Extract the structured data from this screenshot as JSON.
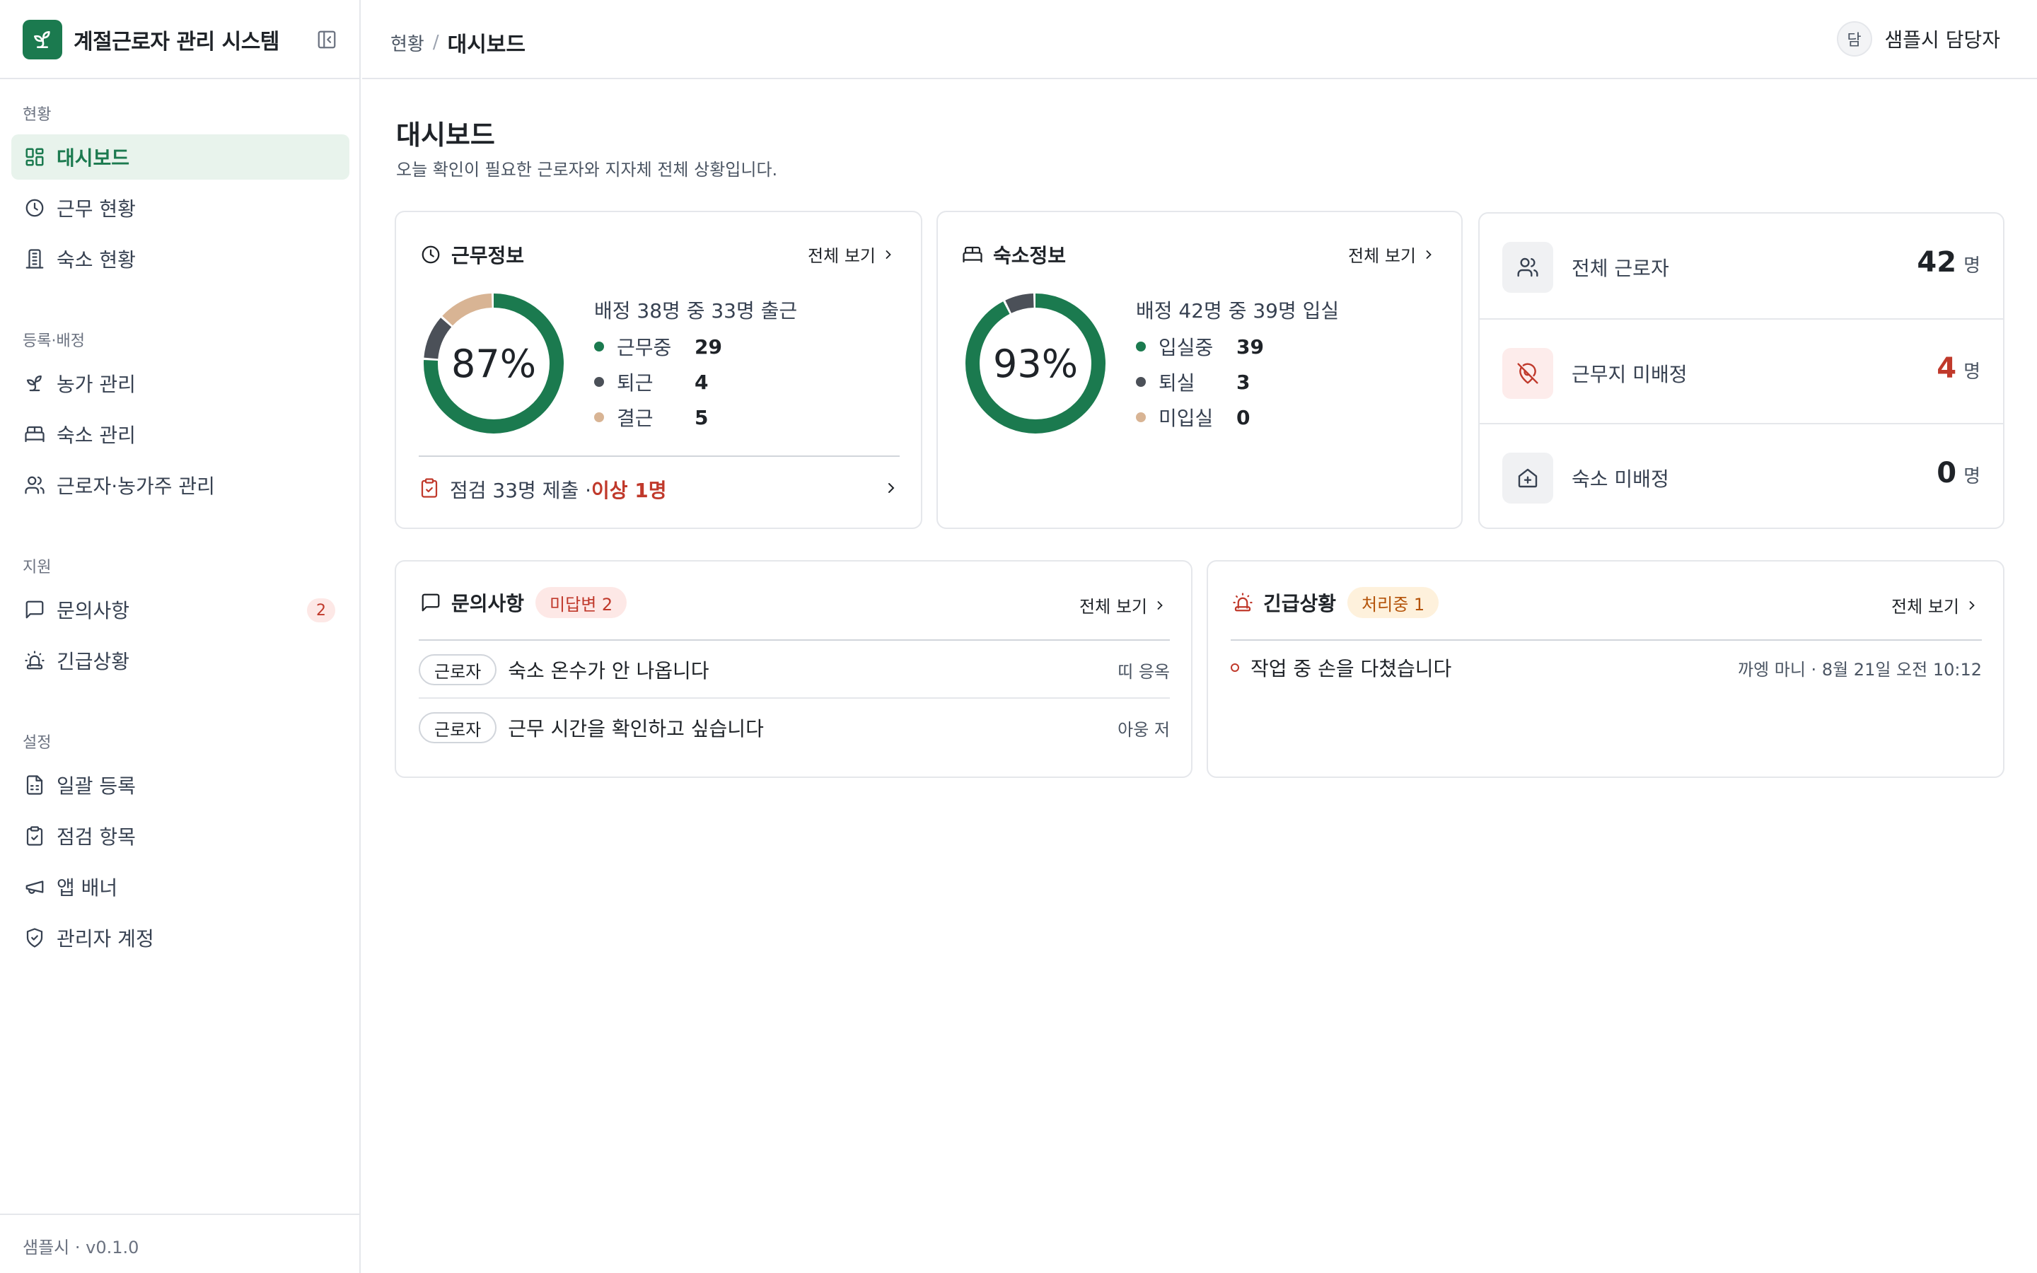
{
  "app": {
    "title": "계절근로자 관리 시스템",
    "version": "샘플시 · v0.1.0"
  },
  "sidebar": {
    "sections": [
      {
        "title": "현황",
        "items": [
          {
            "label": "대시보드",
            "icon": "dashboard-icon",
            "active": true
          },
          {
            "label": "근무 현황",
            "icon": "clock-icon"
          },
          {
            "label": "숙소 현황",
            "icon": "building-icon"
          }
        ]
      },
      {
        "title": "등록·배정",
        "items": [
          {
            "label": "농가 관리",
            "icon": "sprout-icon"
          },
          {
            "label": "숙소 관리",
            "icon": "bed-icon"
          },
          {
            "label": "근로자·농가주 관리",
            "icon": "users-icon"
          }
        ]
      },
      {
        "title": "지원",
        "items": [
          {
            "label": "문의사항",
            "icon": "message-icon",
            "badge": "2"
          },
          {
            "label": "긴급상황",
            "icon": "siren-icon"
          }
        ]
      },
      {
        "title": "설정",
        "items": [
          {
            "label": "일괄 등록",
            "icon": "file-spreadsheet-icon"
          },
          {
            "label": "점검 항목",
            "icon": "clipboard-check-icon"
          },
          {
            "label": "앱 배너",
            "icon": "megaphone-icon"
          },
          {
            "label": "관리자 계정",
            "icon": "shield-check-icon"
          }
        ]
      }
    ]
  },
  "topbar": {
    "breadcrumb_parent": "현황",
    "breadcrumb_sep": "/",
    "breadcrumb_current": "대시보드",
    "user_avatar": "담",
    "user_name": "샘플시 담당자"
  },
  "page": {
    "title": "대시보드",
    "subtitle": "오늘 확인이 필요한 근로자와 지자체 전체 상황입니다."
  },
  "work_card": {
    "title": "근무정보",
    "view_all": "전체 보기",
    "percent": "87%",
    "summary": "배정 38명 중 33명 출근",
    "legend": [
      {
        "label": "근무중",
        "value": "29",
        "color": "#1b7a4f"
      },
      {
        "label": "퇴근",
        "value": "4",
        "color": "#4b5058"
      },
      {
        "label": "결근",
        "value": "5",
        "color": "#d8b494"
      }
    ],
    "inspect_text": "점검 33명 제출 · ",
    "inspect_alert": "이상 1명"
  },
  "housing_card": {
    "title": "숙소정보",
    "view_all": "전체 보기",
    "percent": "93%",
    "summary": "배정 42명 중 39명 입실",
    "legend": [
      {
        "label": "입실중",
        "value": "39",
        "color": "#1b7a4f"
      },
      {
        "label": "퇴실",
        "value": "3",
        "color": "#4b5058"
      },
      {
        "label": "미입실",
        "value": "0",
        "color": "#d8b494"
      }
    ]
  },
  "stats": [
    {
      "label": "전체 근로자",
      "value": "42",
      "unit": "명",
      "icon": "users-icon",
      "value_color": "#1f2328"
    },
    {
      "label": "근무지 미배정",
      "value": "4",
      "unit": "명",
      "icon": "map-pin-off-icon",
      "value_color": "#c0392b"
    },
    {
      "label": "숙소 미배정",
      "value": "0",
      "unit": "명",
      "icon": "house-plus-icon",
      "value_color": "#1f2328"
    }
  ],
  "inquiry_card": {
    "title": "문의사항",
    "badge": "미답변 2",
    "view_all": "전체 보기",
    "rows": [
      {
        "tag": "근로자",
        "text": "숙소 온수가 안 나옵니다",
        "meta": "띠 응옥"
      },
      {
        "tag": "근로자",
        "text": "근무 시간을 확인하고 싶습니다",
        "meta": "아웅 저"
      }
    ]
  },
  "emergency_card": {
    "title": "긴급상황",
    "badge": "처리중 1",
    "view_all": "전체 보기",
    "rows": [
      {
        "text": "작업 중 손을 다쳤습니다",
        "meta": "까엥 마니 · 8월 21일 오전 10:12"
      }
    ]
  },
  "colors": {
    "brand": "#1b7a4f",
    "alert": "#c0392b",
    "dark": "#4b5058",
    "tan": "#d8b494",
    "donut_work": {
      "work": 29,
      "off": 4,
      "absent": 5
    },
    "donut_housing": {
      "in": 39,
      "out": 3,
      "none": 0
    }
  }
}
